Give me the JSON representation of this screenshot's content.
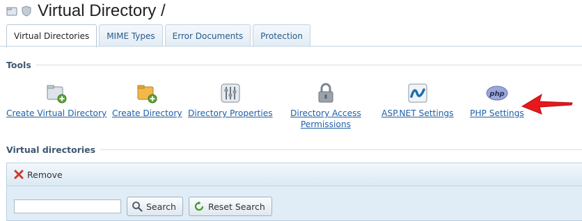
{
  "header": {
    "title": "Virtual Directory /",
    "icons": [
      "folder-icon",
      "shield-icon"
    ]
  },
  "tabs": [
    {
      "label": "Virtual Directories",
      "active": true
    },
    {
      "label": "MIME Types",
      "active": false
    },
    {
      "label": "Error Documents",
      "active": false
    },
    {
      "label": "Protection",
      "active": false
    }
  ],
  "tools": {
    "section_label": "Tools",
    "items": [
      {
        "label": "Create Virtual Directory",
        "icon": "virtual-folder-add-icon"
      },
      {
        "label": "Create Directory",
        "icon": "folder-add-icon"
      },
      {
        "label": "Directory Properties",
        "icon": "sliders-icon"
      },
      {
        "label_line1": "Directory Access",
        "label_line2": "Permissions",
        "icon": "padlock-icon"
      },
      {
        "label": "ASP.NET Settings",
        "icon": "dotnet-icon"
      },
      {
        "label": "PHP Settings",
        "icon": "php-icon",
        "highlighted": true
      }
    ]
  },
  "virtual_dirs": {
    "section_label": "Virtual directories",
    "remove_label": "Remove",
    "search": {
      "value": "",
      "placeholder": ""
    },
    "search_label": "Search",
    "reset_label": "Reset Search"
  },
  "colors": {
    "link": "#1f5fa6",
    "arrow": "#e8181b",
    "accent": "#3f5770"
  }
}
